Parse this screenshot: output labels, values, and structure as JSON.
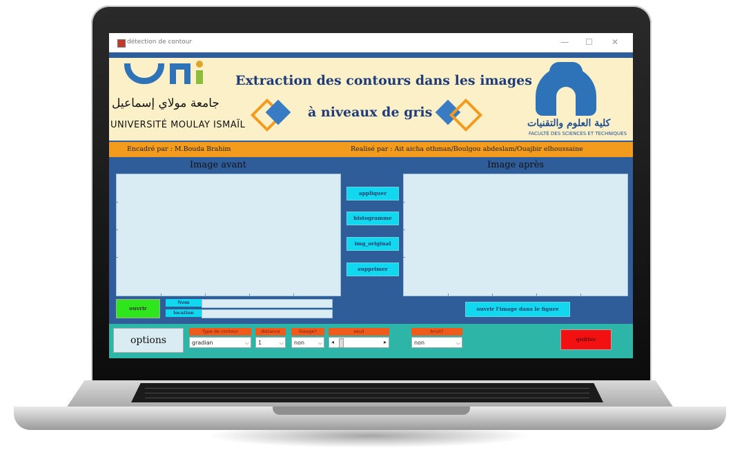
{
  "window": {
    "title": "détection de contour",
    "minimize_label": "—",
    "maximize_label": "☐",
    "close_label": "✕"
  },
  "header": {
    "university_arabic": "جامعة مولاي إسماعيل",
    "university_latin": "UNIVERSITÉ MOULAY ISMAÏL",
    "title_line1": "Extraction des contours dans les images",
    "title_line2": "à niveaux de gris",
    "faculty_arabic": "كلية العلوم والتقنيات",
    "faculty_latin": "FACULTÉ DES SCIENCES ET TECHNIQUES"
  },
  "credits": {
    "supervisor": "Encadré par : M.Bouda Brahim",
    "authors": "Realisé par : Ait aicha othman/Boulgou abdeslam/Ouajbir elhoussaine"
  },
  "panels": {
    "before_label": "Image avant",
    "after_label": "Image après"
  },
  "actions": {
    "apply": "appliquer",
    "histogram": "histogramme",
    "original": "img_original",
    "delete": "supprimer",
    "open": "ouvrir",
    "open_in_figure": "ouvrir l'image dans le figure",
    "quit": "quitter"
  },
  "file_info": {
    "name_label": "Nom",
    "location_label": "location",
    "name_value": "",
    "location_value": ""
  },
  "options": {
    "title": "options",
    "contour_type_label": "Type de contour",
    "contour_type_value": "gradian",
    "distance_label": "distance",
    "distance_value": "1",
    "smoothing_label": "lissage?",
    "smoothing_value": "non",
    "threshold_label": "seuil",
    "noise_label": "bruit?",
    "noise_value": "non"
  },
  "colors": {
    "header_bg": "#fcf0c8",
    "title_blue": "#1f3c78",
    "main_bg": "#2f5d99",
    "credit_bar": "#f29b1c",
    "button_cyan": "#11d8ee",
    "open_green": "#2ee61c",
    "quit_red": "#f21010",
    "options_bg": "#2db6a8",
    "option_label_bg": "#f05a1a"
  }
}
